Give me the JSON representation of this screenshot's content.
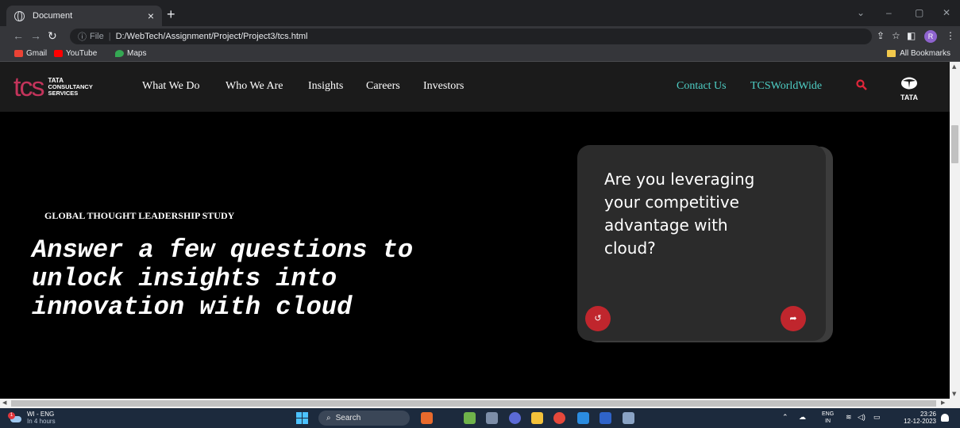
{
  "browser": {
    "tab_title": "Document",
    "tab_close": "×",
    "new_tab": "+",
    "url_scheme": "File",
    "url_separator": "|",
    "url": "D:/WebTech/Assignment/Project/Project3/tcs.html",
    "profile_initial": "R",
    "bookmarks": [
      "Gmail",
      "YouTube",
      "Maps"
    ],
    "all_bookmarks": "All Bookmarks",
    "window_controls": [
      "⌄",
      "–",
      "▢",
      "✕"
    ]
  },
  "site": {
    "logo_mark": "tcs",
    "logo_lines": [
      "TATA",
      "CONSULTANCY",
      "SERVICES"
    ],
    "nav": [
      "What We Do",
      "Who We Are",
      "Insights",
      "Careers",
      "Investors"
    ],
    "nav_right": [
      "Contact Us",
      "TCSWorldWide"
    ],
    "tata_label": "TATA",
    "accent_color": "#4ecfc6",
    "search_color": "#e0263a"
  },
  "hero": {
    "kicker": "GLOBAL THOUGHT LEADERSHIP STUDY",
    "title_lines": [
      "Answer a few questions to",
      "unlock insights into",
      "innovation with cloud"
    ]
  },
  "card": {
    "question_lines": [
      "Are you leveraging",
      "your competitive",
      "advantage with",
      "cloud?"
    ],
    "back_icon": "↺",
    "next_icon": "➦",
    "button_color": "#c0262d"
  },
  "taskbar": {
    "weather_title": "WI - ENG",
    "weather_sub": "In 4 hours",
    "weather_badge": "1",
    "search_placeholder": "Search",
    "lang_top": "ENG",
    "lang_bottom": "IN",
    "time": "23:26",
    "date": "12-12-2023"
  }
}
